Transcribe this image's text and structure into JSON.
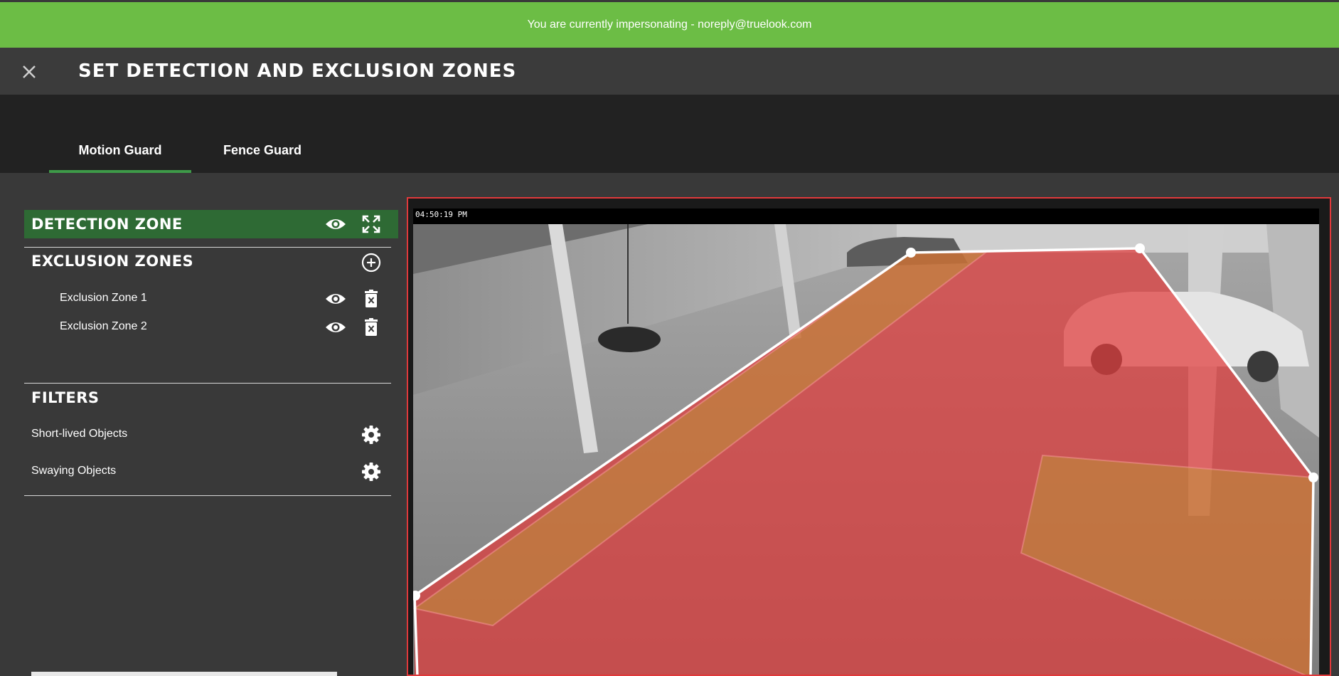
{
  "banner": {
    "text": "You are currently impersonating - noreply@truelook.com"
  },
  "header": {
    "title": "SET DETECTION AND EXCLUSION ZONES",
    "close_icon": "close-icon"
  },
  "tabs": [
    {
      "label": "Motion Guard",
      "active": true
    },
    {
      "label": "Fence Guard",
      "active": false
    }
  ],
  "sidebar": {
    "detection_zone": {
      "title": "DETECTION ZONE",
      "icons": [
        "eye-icon",
        "expand-icon"
      ]
    },
    "exclusion_zones": {
      "title": "EXCLUSION ZONES",
      "add_icon": "add-circle-icon",
      "items": [
        {
          "label": "Exclusion Zone 1"
        },
        {
          "label": "Exclusion Zone 2"
        }
      ]
    },
    "filters": {
      "title": "FILTERS",
      "items": [
        {
          "label": "Short-lived Objects"
        },
        {
          "label": "Swaying Objects"
        }
      ]
    }
  },
  "camera": {
    "timestamp": "04:50:19 PM"
  },
  "colors": {
    "banner": "#6cbd45",
    "detection_header": "#2e6a34",
    "tab_active": "#3e9a48",
    "frame_border": "#e0393b",
    "detection_fill": "#e03c3c",
    "exclusion_fill": "#b8a030"
  }
}
